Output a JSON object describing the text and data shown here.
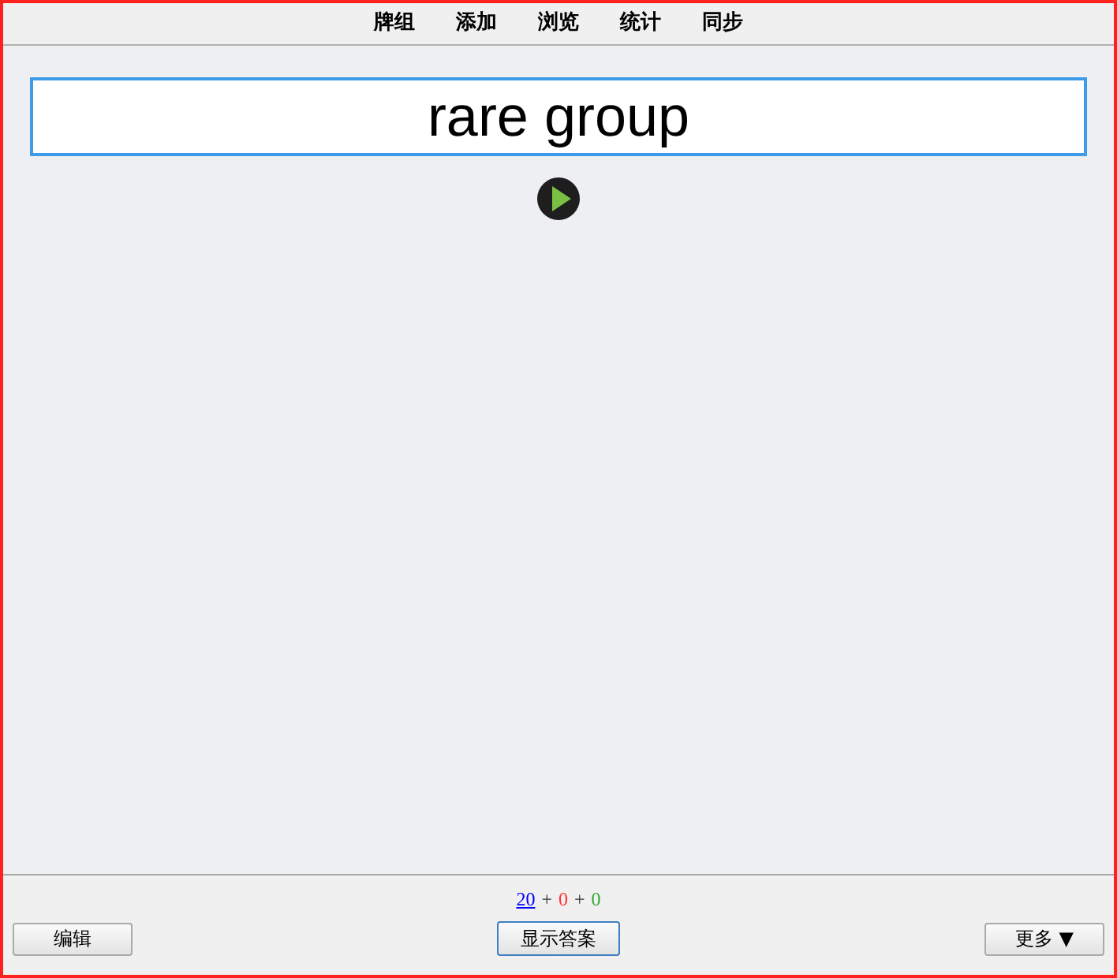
{
  "menu": [
    {
      "label": "牌组"
    },
    {
      "label": "添加"
    },
    {
      "label": "浏览"
    },
    {
      "label": "统计"
    },
    {
      "label": "同步"
    }
  ],
  "answer_field": {
    "value": "rare group"
  },
  "counts": {
    "separator": "+",
    "items": [
      {
        "text": "20",
        "color": "#0000ff",
        "link": true
      },
      {
        "text": "0",
        "color": "#ff3333",
        "link": false
      },
      {
        "text": "0",
        "color": "#33aa33",
        "link": false
      }
    ]
  },
  "buttons": {
    "edit": "编辑",
    "show_answer": "显示答案",
    "more": "更多 ▼"
  }
}
